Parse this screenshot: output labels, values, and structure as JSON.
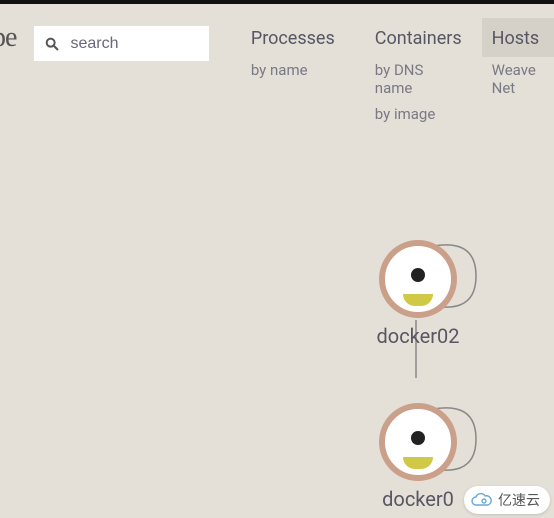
{
  "logo_fragment": "pe",
  "search": {
    "placeholder": "search",
    "value": ""
  },
  "tabs": [
    {
      "label": "Processes",
      "subs": [
        "by name"
      ],
      "active": false
    },
    {
      "label": "Containers",
      "subs": [
        "by DNS name",
        "by image"
      ],
      "active": false
    },
    {
      "label": "Hosts",
      "subs": [
        "Weave Net"
      ],
      "active": true
    }
  ],
  "nodes": [
    {
      "label": "docker02"
    },
    {
      "label": "docker0"
    }
  ],
  "watermark": "亿速云"
}
